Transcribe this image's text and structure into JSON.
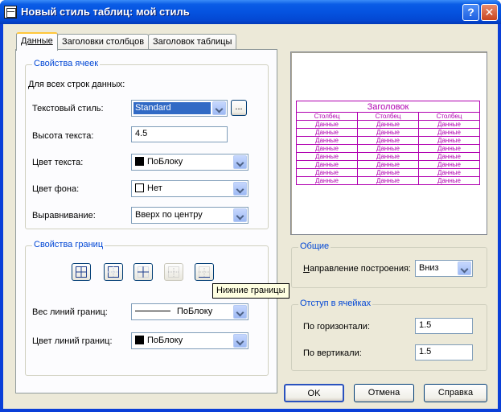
{
  "window": {
    "title": "Новый стиль таблиц: мой стиль",
    "help_glyph": "?",
    "close_glyph": "✕"
  },
  "tabs": [
    {
      "label": "Данные",
      "active": true
    },
    {
      "label": "Заголовки столбцов",
      "active": false
    },
    {
      "label": "Заголовок таблицы",
      "active": false
    }
  ],
  "cell_props": {
    "title": "Свойства ячеек",
    "subtitle": "Для всех строк данных:",
    "text_style_label": "Текстовый стиль:",
    "text_style_value": "Standard",
    "browse_label": "...",
    "text_height_label": "Высота текста:",
    "text_height_value": "4.5",
    "text_color_label": "Цвет текста:",
    "text_color_value": "ПоБлоку",
    "bg_color_label": "Цвет фона:",
    "bg_color_value": "Нет",
    "alignment_label": "Выравнивание:",
    "alignment_value": "Вверх по центру"
  },
  "border_props": {
    "title": "Свойства границ",
    "tooltip": "Нижние границы",
    "lineweight_label": "Вес линий границ:",
    "lineweight_value": "ПоБлоку",
    "linecolor_label": "Цвет линий границ:",
    "linecolor_value": "ПоБлоку"
  },
  "preview": {
    "title": "Заголовок",
    "headers": [
      "Столбец",
      "Столбец",
      "Столбец"
    ],
    "cell": "Данные",
    "rows": 8,
    "color": "#b000b0"
  },
  "general": {
    "title": "Общие",
    "direction_label": "Направление построения:",
    "direction_value": "Вниз"
  },
  "margins": {
    "title": "Отступ в ячейках",
    "horizontal_label": "По горизонтали:",
    "horizontal_value": "1.5",
    "vertical_label": "По вертикали:",
    "vertical_value": "1.5"
  },
  "buttons": {
    "ok": "OK",
    "cancel": "Отмена",
    "help": "Справка"
  },
  "colors": {
    "titlebar": "#0553e0",
    "dialog_bg": "#ece9d8",
    "group_title": "#0046d5",
    "selection": "#316ac5",
    "tooltip_bg": "#ffffe1"
  }
}
